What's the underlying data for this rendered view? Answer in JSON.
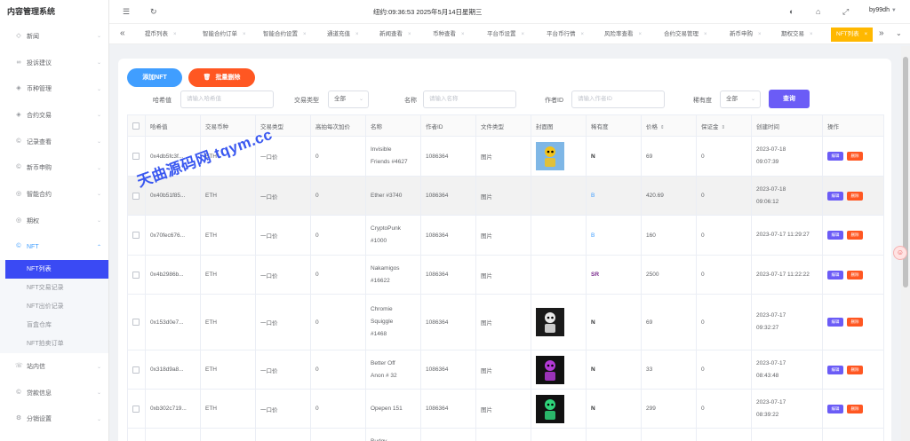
{
  "app_title": "内容管理系统",
  "header": {
    "clock": "纽约:09:36:53 2025年5月14日星期三",
    "user": "by99dh"
  },
  "sidebar": {
    "items": [
      {
        "label": "新闻",
        "icon": "tag-icon"
      },
      {
        "label": "投诉建议",
        "icon": "infinity-icon"
      },
      {
        "label": "币种管理",
        "icon": "diamond-icon"
      },
      {
        "label": "合约交易",
        "icon": "diamond-icon"
      },
      {
        "label": "记录查看",
        "icon": "coin-icon"
      },
      {
        "label": "新币申购",
        "icon": "coin-icon"
      },
      {
        "label": "智能合约",
        "icon": "chart-icon"
      },
      {
        "label": "期权",
        "icon": "chart-icon"
      },
      {
        "label": "NFT",
        "icon": "coin-icon"
      }
    ],
    "nft_sub": [
      "NFT列表",
      "NFT交易记录",
      "NFT出价记录",
      "盲盒仓库",
      "NFT拍卖订单"
    ],
    "bottom_items": [
      {
        "label": "站内信",
        "icon": "chat-icon"
      },
      {
        "label": "贷款信息",
        "icon": "coin-icon"
      },
      {
        "label": "分销设置",
        "icon": "gear-icon"
      }
    ]
  },
  "tags": [
    "提币列表",
    "智能合约订单",
    "智能合约设置",
    "通道充值",
    "新闻查看",
    "币种查看",
    "平台币设置",
    "平台币行情",
    "风险率查看",
    "合约交易管理",
    "新币申购",
    "期权交易",
    "NFT列表"
  ],
  "toolbar": {
    "add": "添加NFT",
    "batch_delete": "批量删除"
  },
  "filters": {
    "hash_label": "哈希值",
    "hash_placeholder": "请输入哈希值",
    "type_label": "交易类型",
    "type_value": "全部",
    "name_label": "名称",
    "name_placeholder": "请输入名称",
    "author_label": "作者ID",
    "author_placeholder": "请输入作者ID",
    "rarity_label": "稀有度",
    "rarity_value": "全部",
    "query": "查询"
  },
  "table": {
    "columns": [
      "哈希值",
      "交易币种",
      "交易类型",
      "高拍每次加价",
      "名称",
      "作者ID",
      "文件类型",
      "封面图",
      "稀有度",
      "价格",
      "保证金",
      "创建时间",
      "操作"
    ],
    "edit_label": "编辑",
    "delete_label": "删除",
    "rows": [
      {
        "hash": "0x4db5fc3f...",
        "coin": "ETH",
        "type": "一口价",
        "incr": "0",
        "name1": "Invisible",
        "name2": "Friends #4627",
        "author": "1086364",
        "file": "图片",
        "rarity": "N",
        "price": "69",
        "deposit": "0",
        "date": "2023-07-18",
        "time": "09:07:39",
        "thumb": "yellow"
      },
      {
        "hash": "0x40b51f85...",
        "coin": "ETH",
        "type": "一口价",
        "incr": "0",
        "name1": "Ether #3740",
        "name2": "",
        "author": "1086364",
        "file": "图片",
        "rarity": "B",
        "price": "420.69",
        "deposit": "0",
        "date": "2023-07-18",
        "time": "09:06:12",
        "thumb": ""
      },
      {
        "hash": "0x70fec676...",
        "coin": "ETH",
        "type": "一口价",
        "incr": "0",
        "name1": "CryptoPunk",
        "name2": "#1000",
        "author": "1086364",
        "file": "图片",
        "rarity": "B",
        "price": "160",
        "deposit": "0",
        "date": "2023-07-17 11:29:27",
        "time": "",
        "thumb": ""
      },
      {
        "hash": "0x4b2986b...",
        "coin": "ETH",
        "type": "一口价",
        "incr": "0",
        "name1": "Nakamigos",
        "name2": "#16622",
        "author": "1086364",
        "file": "图片",
        "rarity": "SR",
        "price": "2500",
        "deposit": "0",
        "date": "2023-07-17 11:22:22",
        "time": "",
        "thumb": ""
      },
      {
        "hash": "0x153d0e7...",
        "coin": "ETH",
        "type": "一口价",
        "incr": "0",
        "name1": "Chromie",
        "name2": "Squiggle",
        "name3": "#1468",
        "author": "1086364",
        "file": "图片",
        "rarity": "N",
        "price": "69",
        "deposit": "0",
        "date": "2023-07-17",
        "time": "09:32:27",
        "thumb": "dark"
      },
      {
        "hash": "0x318d9a8...",
        "coin": "ETH",
        "type": "一口价",
        "incr": "0",
        "name1": "Better Off",
        "name2": "Anon # 32",
        "author": "1086364",
        "file": "图片",
        "rarity": "N",
        "price": "33",
        "deposit": "0",
        "date": "2023-07-17",
        "time": "08:43:48",
        "thumb": "purple"
      },
      {
        "hash": "0xb302c719...",
        "coin": "ETH",
        "type": "一口价",
        "incr": "0",
        "name1": "Opepen 151",
        "name2": "",
        "author": "1086364",
        "file": "图片",
        "rarity": "N",
        "price": "299",
        "deposit": "0",
        "date": "2023-07-17",
        "time": "08:39:22",
        "thumb": "green"
      },
      {
        "hash": "",
        "coin": "",
        "type": "",
        "incr": "",
        "name1": "Budgy",
        "name2": "",
        "author": "",
        "file": "",
        "rarity": "",
        "price": "",
        "deposit": "",
        "date": "",
        "time": "",
        "thumb": ""
      }
    ]
  },
  "watermark": "天曲源码网 tqym.cc",
  "colors": {
    "primary": "#409eff",
    "danger": "#ff5722",
    "violet": "#6b5cf6",
    "active_menu": "#3a4af4",
    "active_tag": "#ffb800"
  }
}
